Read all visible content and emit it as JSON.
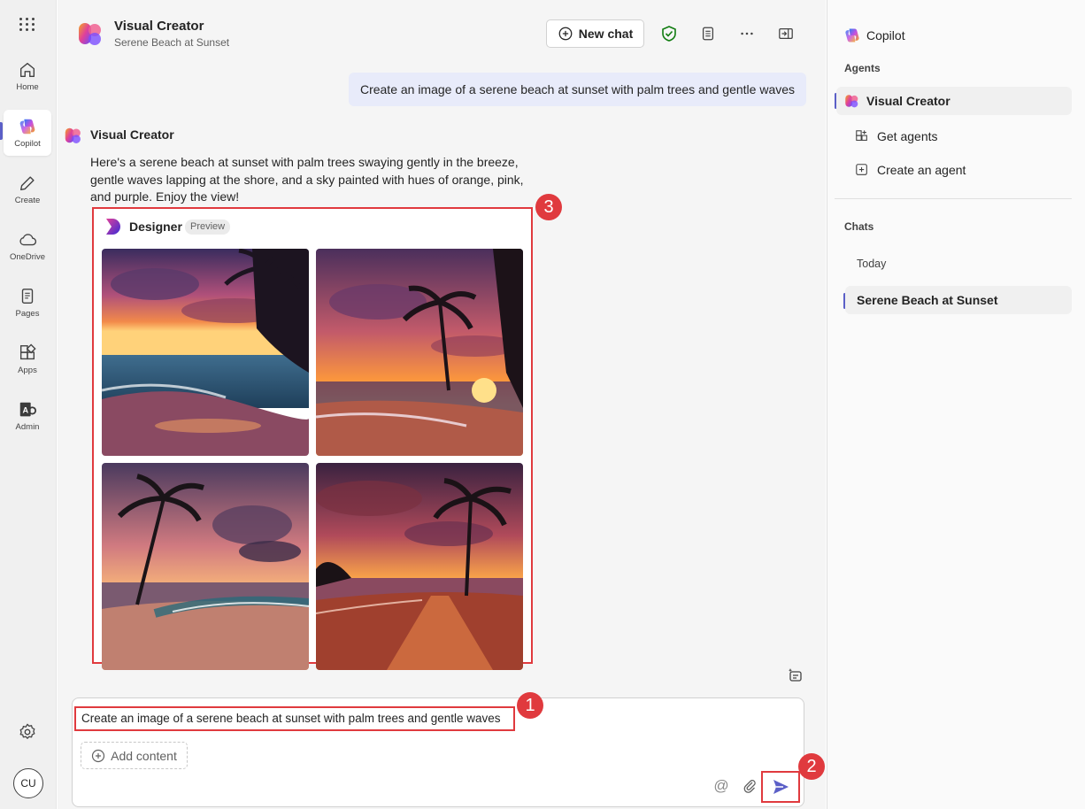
{
  "app": {
    "rail": [
      {
        "label": "Home",
        "icon": "home-icon"
      },
      {
        "label": "Copilot",
        "icon": "copilot-icon"
      },
      {
        "label": "Create",
        "icon": "pencil-icon"
      },
      {
        "label": "OneDrive",
        "icon": "cloud-icon"
      },
      {
        "label": "Pages",
        "icon": "pages-icon"
      },
      {
        "label": "Apps",
        "icon": "apps-icon"
      },
      {
        "label": "Admin",
        "icon": "admin-icon"
      }
    ],
    "avatar_initials": "CU"
  },
  "header": {
    "title": "Visual Creator",
    "subtitle": "Serene Beach at Sunset",
    "new_chat_label": "New chat"
  },
  "conversation": {
    "user_message": "Create an image of a serene beach at sunset with palm trees and gentle waves",
    "bot_name": "Visual Creator",
    "bot_text": "Here's a serene beach at sunset with palm trees swaying gently in the breeze, gentle waves lapping at the shore, and a sky painted with hues of orange, pink, and purple. Enjoy the view!",
    "designer": {
      "name": "Designer",
      "badge": "Preview"
    }
  },
  "composer": {
    "text": "Create an image of a serene beach at sunset with palm trees and gentle waves",
    "add_content_label": "Add content",
    "mention_glyph": "@"
  },
  "callouts": [
    "1",
    "2",
    "3"
  ],
  "right_panel": {
    "title": "Copilot",
    "agents_heading": "Agents",
    "agents": [
      {
        "label": "Visual Creator",
        "selected": true
      },
      {
        "label": "Get agents",
        "selected": false
      },
      {
        "label": "Create an agent",
        "selected": false
      }
    ],
    "chats_heading": "Chats",
    "chats_group": "Today",
    "chats": [
      {
        "label": "Serene Beach at Sunset",
        "selected": true
      }
    ]
  },
  "colors": {
    "accent": "#5b5fc7",
    "callout": "#e03a3e",
    "user_bubble": "#e8ebfa"
  }
}
